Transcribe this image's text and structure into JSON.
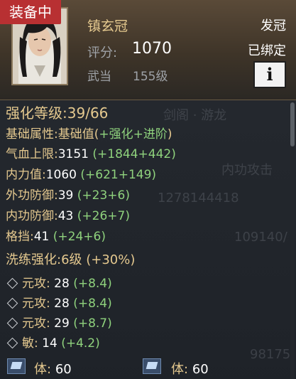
{
  "header": {
    "equip_badge": "装备中",
    "item_name": "镇玄冠",
    "score_label": "评分:",
    "score_value": "1070",
    "sect": "武当",
    "level": "155级",
    "slot": "发冠",
    "bound": "已绑定",
    "info_button": "i"
  },
  "stats": {
    "enhance_label": "强化等级:",
    "enhance_value": "39/66",
    "base_attr_label": "基础属性:",
    "base_attr_desc_prefix": "基础值(",
    "base_attr_desc_enhance": "+强化",
    "base_attr_desc_advance": "+进阶",
    "base_attr_desc_suffix": ")",
    "rows": [
      {
        "label": "气血上限:",
        "base": "3151",
        "bonus": "(+1844+442)"
      },
      {
        "label": "内力值:",
        "base": "1060",
        "bonus": "(+621+149)"
      },
      {
        "label": "外功防御:",
        "base": "39",
        "bonus": "(+23+6)"
      },
      {
        "label": "内功防御:",
        "base": "43",
        "bonus": "(+26+7)"
      },
      {
        "label": "格挡:",
        "base": "41",
        "bonus": "(+24+6)"
      }
    ],
    "refine_label": "洗练强化:",
    "refine_value": "6级 (+30%)",
    "refine_rows": [
      {
        "label": "元攻:",
        "base": "28",
        "bonus": "(+8.4)"
      },
      {
        "label": "元攻:",
        "base": "28",
        "bonus": "(+8.4)"
      },
      {
        "label": "元攻:",
        "base": "29",
        "bonus": "(+8.7)"
      },
      {
        "label": "敏:",
        "base": "14",
        "bonus": "(+4.2)"
      }
    ],
    "gems": [
      {
        "label": "体:",
        "value": "60"
      },
      {
        "label": "体:",
        "value": "60"
      }
    ]
  },
  "background_ghost": {
    "t1": "剑阁 · 游龙",
    "t2": "内功攻击",
    "t3": "1278144418",
    "t4": "109140/",
    "t5": "98175"
  },
  "colors": {
    "badge": "#b83032",
    "title_gold": "#e5c98f",
    "bonus_green": "#8fd27d"
  }
}
